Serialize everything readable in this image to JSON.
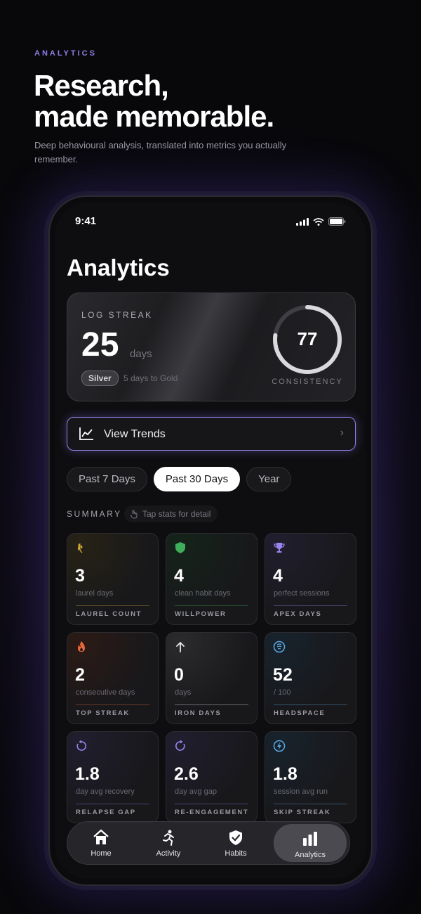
{
  "hero": {
    "eyebrow": "ANALYTICS",
    "headline_line1": "Research,",
    "headline_line2": "made memorable.",
    "subhead": "Deep behavioural analysis, translated into metrics you actually remember."
  },
  "status_bar": {
    "time": "9:41"
  },
  "page": {
    "title": "Analytics"
  },
  "streak": {
    "label": "LOG STREAK",
    "value": "25",
    "unit": "days",
    "badge": "Silver",
    "badge_note": "5 days to Gold",
    "consistency_value": "77",
    "consistency_fraction": 0.77,
    "consistency_label": "CONSISTENCY"
  },
  "trends": {
    "label": "View Trends"
  },
  "periods": [
    {
      "label": "Past 7 Days",
      "active": false
    },
    {
      "label": "Past 30 Days",
      "active": true
    },
    {
      "label": "Year",
      "active": false
    }
  ],
  "summary": {
    "label": "SUMMARY",
    "hint": "Tap stats for detail"
  },
  "tiles": [
    {
      "value": "3",
      "desc": "laurel days",
      "name": "LAUREL COUNT",
      "icon": "laurel-icon",
      "color": "#c9a53a"
    },
    {
      "value": "4",
      "desc": "clean habit days",
      "name": "WILLPOWER",
      "icon": "shield-icon",
      "color": "#3fae5a"
    },
    {
      "value": "4",
      "desc": "perfect sessions",
      "name": "APEX DAYS",
      "icon": "trophy-icon",
      "color": "#9a84f0"
    },
    {
      "value": "2",
      "desc": "consecutive days",
      "name": "TOP STREAK",
      "icon": "flame-icon",
      "color": "#e8683a"
    },
    {
      "value": "0",
      "desc": "days",
      "name": "IRON DAYS",
      "icon": "arrow-up-icon",
      "color": "#e6e6ea"
    },
    {
      "value": "52",
      "desc": "/ 100",
      "name": "HEADSPACE",
      "icon": "brain-icon",
      "color": "#5aa9e6"
    },
    {
      "value": "1.8",
      "desc": "day avg recovery",
      "name": "RELAPSE GAP",
      "icon": "undo-icon",
      "color": "#9a84f0"
    },
    {
      "value": "2.6",
      "desc": "day avg gap",
      "name": "RE-ENGAGEMENT",
      "icon": "refresh-icon",
      "color": "#9a84f0"
    },
    {
      "value": "1.8",
      "desc": "session avg run",
      "name": "SKIP STREAK",
      "icon": "bolt-icon",
      "color": "#5aa9e6"
    }
  ],
  "tabbar": [
    {
      "label": "Home",
      "icon": "home-icon",
      "active": false
    },
    {
      "label": "Activity",
      "icon": "running-icon",
      "active": false
    },
    {
      "label": "Habits",
      "icon": "shield-check-icon",
      "active": false
    },
    {
      "label": "Analytics",
      "icon": "bar-chart-icon",
      "active": true
    }
  ]
}
